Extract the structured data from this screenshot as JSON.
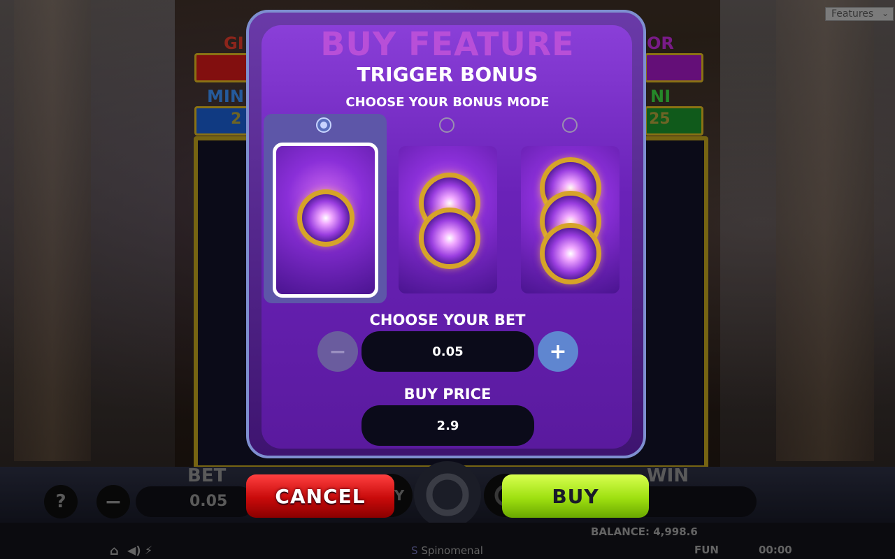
{
  "features_select": {
    "value": "Features"
  },
  "background": {
    "jackpot_left_top": "GI",
    "jackpot_right_top": "OR",
    "jackpot_left_mini": "MIN",
    "jackpot_right_mini": "NI",
    "jackpot_left_value": "2",
    "jackpot_right_value": "25"
  },
  "modal": {
    "title": "BUY FEATURE",
    "subtitle": "TRIGGER BONUS",
    "mode_prompt": "CHOOSE YOUR BONUS MODE",
    "modes": [
      {
        "orbs": 1,
        "selected": true
      },
      {
        "orbs": 2,
        "selected": false
      },
      {
        "orbs": 3,
        "selected": false
      }
    ],
    "bet_label": "CHOOSE YOUR BET",
    "bet_value": "0.05",
    "price_label": "BUY PRICE",
    "price_value": "2.9"
  },
  "buttons": {
    "cancel": "CANCEL",
    "buy": "BUY"
  },
  "bottom_bar": {
    "help": "?",
    "bet_label": "BET",
    "bet_value": "0.05",
    "win_label": "WIN",
    "partial_buy": "Y"
  },
  "footer": {
    "balance": "BALANCE: 4,998.6",
    "brand": "Spinomenal",
    "mode": "FUN",
    "time": "00:00"
  },
  "colors": {
    "title_purple": "#b84fd8",
    "cancel_red": "#d01010",
    "buy_green": "#9ee010",
    "plus_blue": "#5f86d0"
  }
}
